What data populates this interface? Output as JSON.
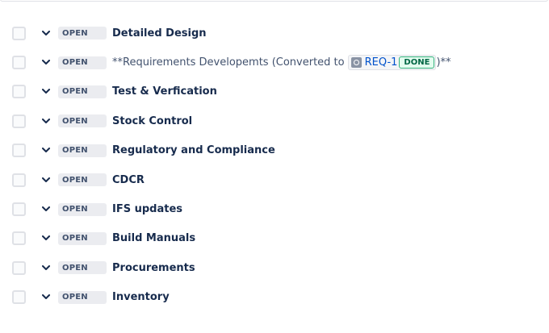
{
  "rows": [
    {
      "status": "OPEN",
      "summary": "Detailed Design"
    },
    {
      "status": "OPEN",
      "summary_prefix": "**Requirements Developemts (Converted to",
      "link_key": "REQ-1",
      "link_status": "DONE",
      "summary_suffix": ")**"
    },
    {
      "status": "OPEN",
      "summary": "Test & Verfication"
    },
    {
      "status": "OPEN",
      "summary": "Stock Control"
    },
    {
      "status": "OPEN",
      "summary": "Regulatory and Compliance"
    },
    {
      "status": "OPEN",
      "summary": "CDCR"
    },
    {
      "status": "OPEN",
      "summary": "IFS updates"
    },
    {
      "status": "OPEN",
      "summary": "Build Manuals"
    },
    {
      "status": "OPEN",
      "summary": "Procurements"
    },
    {
      "status": "OPEN",
      "summary": "Inventory"
    }
  ],
  "icons": {
    "expand": "chevron-down-icon",
    "link_type": "issue-type-icon"
  },
  "colors": {
    "status_bg": "#ebecf0",
    "status_text": "#42526e",
    "done_border": "#36b37e",
    "link": "#0052cc"
  }
}
